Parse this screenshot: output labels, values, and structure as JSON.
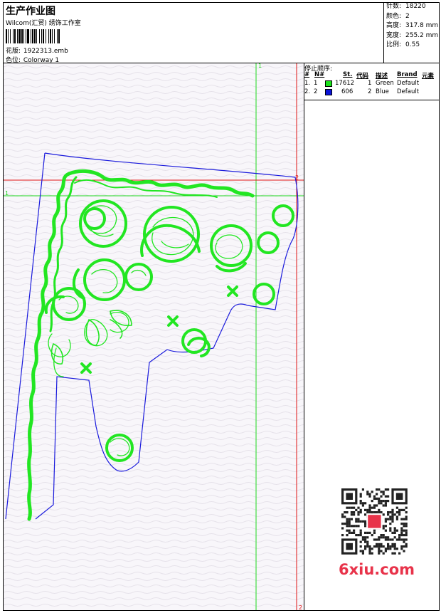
{
  "header": {
    "title": "生产作业图",
    "company": "Wilcom(汇贸) 绣饰工作室",
    "design_label": "花版:",
    "design_value": "1922313.emb",
    "colorway_label": "色位:",
    "colorway_value": "Colorway 1"
  },
  "stats": [
    {
      "label": "针数:",
      "value": "18220"
    },
    {
      "label": "颜色:",
      "value": "2"
    },
    {
      "label": "高度:",
      "value": "317.8 mm"
    },
    {
      "label": "宽度:",
      "value": "255.2 mm"
    },
    {
      "label": "比例:",
      "value": "0.55"
    }
  ],
  "stop_sequence": {
    "title": "停止顺序:",
    "headers": [
      "#",
      "N#",
      "St.",
      "代码",
      "描述",
      "Brand",
      "元素"
    ],
    "rows": [
      {
        "idx": "1.",
        "n": "1",
        "color": "#1be21b",
        "stitches": "17612",
        "code": "1",
        "desc": "Green",
        "brand": "Default"
      },
      {
        "idx": "2.",
        "n": "2",
        "color": "#0a14d8",
        "stitches": "606",
        "code": "2",
        "desc": "Blue",
        "brand": "Default"
      }
    ]
  },
  "guides": {
    "green_vertical_label": "1",
    "green_horizontal_label": "1",
    "red_horizontal_label": "2",
    "red_vertical_label": "2"
  },
  "colors": {
    "guide_green": "#1ed81e",
    "guide_red": "#e01414",
    "outline_blue": "#1a1adc",
    "embroidery_green": "#22e622"
  },
  "watermark": "6xiu.com",
  "qr_badge": "Q\n图"
}
